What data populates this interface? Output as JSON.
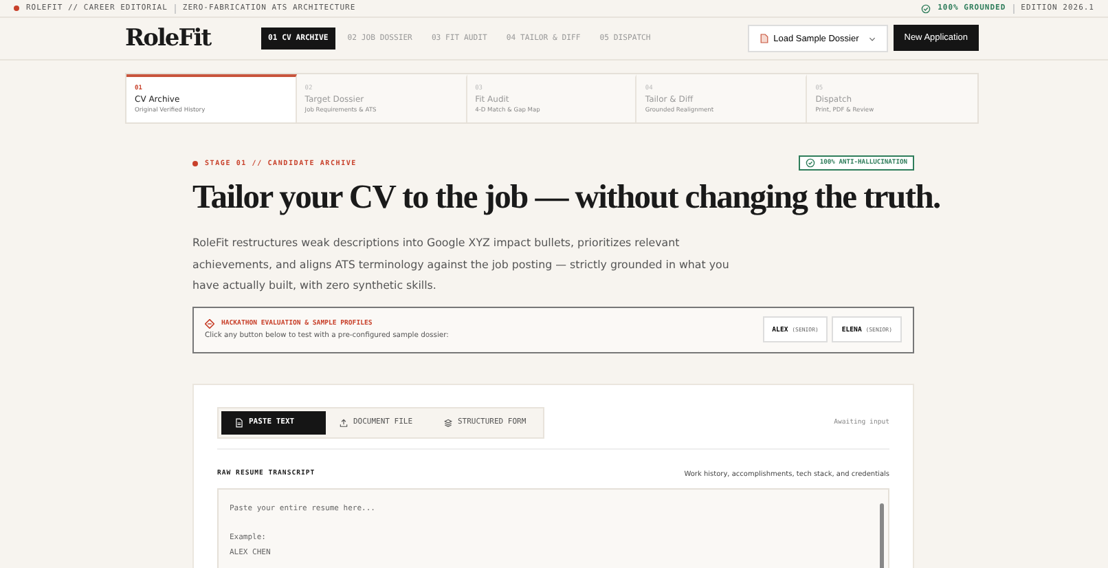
{
  "top_bar": {
    "left": "ROLEFIT // CAREER EDITORIAL",
    "tagline": "ZERO-FABRICATION ATS ARCHITECTURE",
    "status": "100% GROUNDED",
    "edition": "EDITION 2026.1"
  },
  "header": {
    "logo": "RoleFit",
    "nav": [
      {
        "label": "01 CV ARCHIVE",
        "selected": true
      },
      {
        "label": "02 JOB DOSSIER",
        "selected": false
      },
      {
        "label": "03 FIT AUDIT",
        "selected": false
      },
      {
        "label": "04 TAILOR & DIFF",
        "selected": false
      },
      {
        "label": "05 DISPATCH",
        "selected": false
      }
    ],
    "load_button": "Load Sample Dossier",
    "new_button": "New Application"
  },
  "stepper": [
    {
      "number": "01",
      "title": "CV Archive",
      "subtitle": "Original Verified History",
      "selected": true
    },
    {
      "number": "02",
      "title": "Target Dossier",
      "subtitle": "Job Requirements & ATS",
      "selected": false
    },
    {
      "number": "03",
      "title": "Fit Audit",
      "subtitle": "4-D Match & Gap Map",
      "selected": false
    },
    {
      "number": "04",
      "title": "Tailor & Diff",
      "subtitle": "Grounded Realignment",
      "selected": false
    },
    {
      "number": "05",
      "title": "Dispatch",
      "subtitle": "Print, PDF & Review",
      "selected": false
    }
  ],
  "stage_label": "STAGE 01 // CANDIDATE ARCHIVE",
  "badge": "100% ANTI-HALLUCINATION",
  "headline": "Tailor your CV to the job — without changing the truth.",
  "intro": "RoleFit restructures weak descriptions into Google XYZ impact bullets, prioritizes relevant achievements, and aligns ATS terminology against the job posting — strictly grounded in what you have actually built, with zero synthetic skills.",
  "samples": {
    "title": "HACKATHON EVALUATION & SAMPLE PROFILES",
    "text": "Click any button below to test with a pre-configured sample dossier:",
    "profiles": [
      {
        "name": "ALEX",
        "level": "(SENIOR)"
      },
      {
        "name": "ELENA",
        "level": "(SENIOR)"
      }
    ]
  },
  "input_card": {
    "modes": [
      {
        "label": "PASTE TEXT",
        "kind": "paste",
        "selected": true
      },
      {
        "label": "DOCUMENT FILE",
        "kind": "upload",
        "selected": false
      },
      {
        "label": "STRUCTURED FORM",
        "kind": "form",
        "selected": false
      }
    ],
    "status": "Awaiting input",
    "field_label": "RAW RESUME TRANSCRIPT",
    "field_hint": "Work history, accomplishments, tech stack, and credentials",
    "placeholder": "Paste your entire resume here...\n\nExample:\nALEX CHEN"
  }
}
